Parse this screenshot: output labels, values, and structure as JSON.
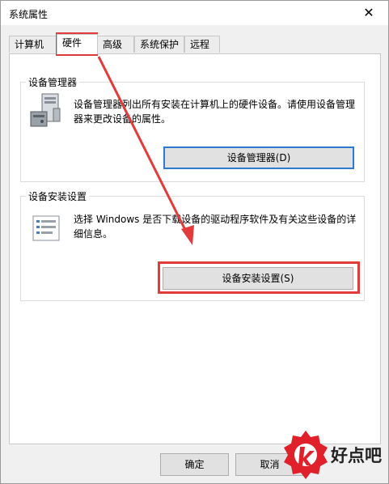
{
  "window": {
    "title": "系统属性",
    "close_glyph": "✕"
  },
  "tabs": [
    {
      "label": "计算机名"
    },
    {
      "label": "硬件",
      "active": true
    },
    {
      "label": "高级"
    },
    {
      "label": "系统保护"
    },
    {
      "label": "远程"
    }
  ],
  "device_manager": {
    "title": "设备管理器",
    "description": "设备管理器列出所有安装在计算机上的硬件设备。请使用设备管理器来更改设备的属性。",
    "button": "设备管理器(D)"
  },
  "device_install": {
    "title": "设备安装设置",
    "description": "选择 Windows 是否下载设备的驱动程序软件及有关这些设备的详细信息。",
    "button": "设备安装设置(S)"
  },
  "footer": {
    "ok": "确定",
    "cancel": "取消"
  },
  "watermark": {
    "text": "好点吧"
  },
  "colors": {
    "highlight": "#e23b3b",
    "focus_border": "#2d7ad3",
    "logo": "#e0202a"
  }
}
